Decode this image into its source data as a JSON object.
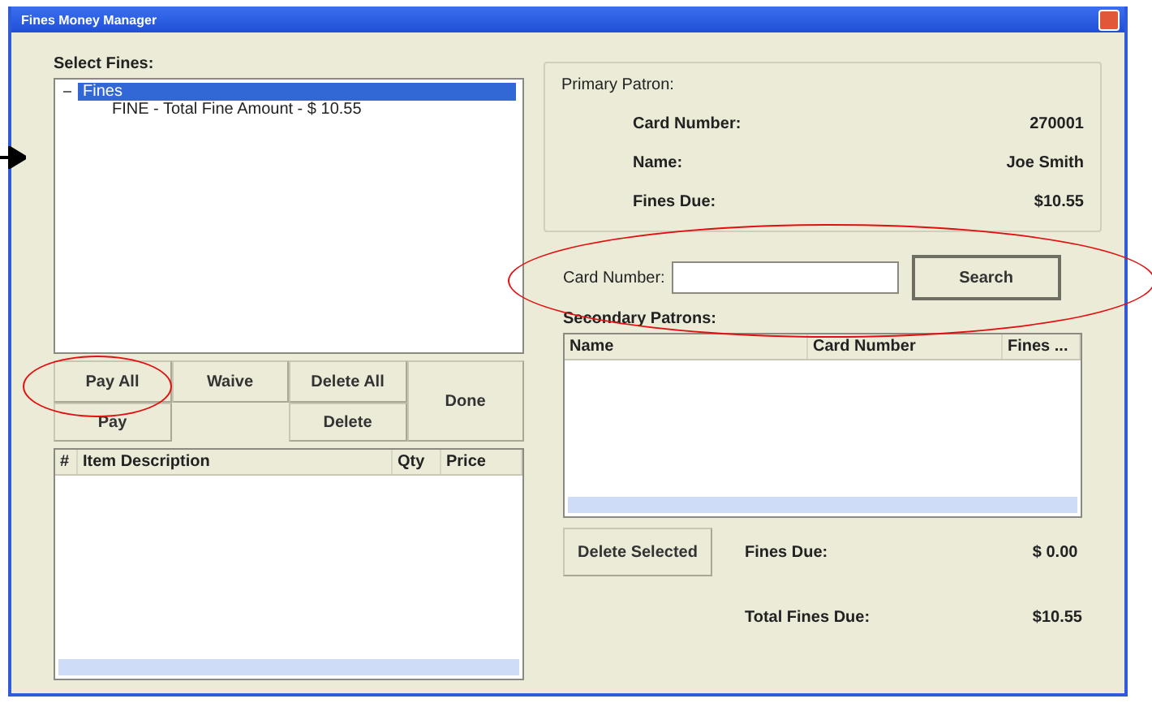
{
  "window": {
    "title": "Fines Money Manager"
  },
  "select_fines": {
    "label": "Select Fines:",
    "tree": [
      {
        "label": "Fines",
        "selected": true,
        "expanded": true,
        "children": [
          {
            "label": "FINE - Total Fine Amount - $ 10.55",
            "selected": false
          }
        ]
      }
    ]
  },
  "actions": [
    {
      "label": "Pay All"
    },
    {
      "label": "Waive"
    },
    {
      "label": "Delete All"
    },
    {
      "label": "Done"
    },
    {
      "label": "Pay"
    },
    {
      "label": "Delete"
    }
  ],
  "items_table": {
    "columns": [
      "#",
      "Item Description",
      "Qty",
      "Price"
    ]
  },
  "primary_patron": {
    "title": "Primary Patron:",
    "fields": [
      {
        "label": "Card Number:",
        "value": "270001"
      },
      {
        "label": "Name:",
        "value": "Joe Smith"
      },
      {
        "label": "Fines Due:",
        "value": "$10.55"
      }
    ]
  },
  "search": {
    "label": "Card Number:",
    "button": "Search"
  },
  "secondary_patrons": {
    "label": "Secondary Patrons:",
    "columns": [
      "Name",
      "Card Number",
      "Fines ..."
    ]
  },
  "delete_selected": "Delete Selected",
  "fines_due": {
    "label": "Fines Due:",
    "value": "$ 0.00"
  },
  "total_fines_due": {
    "label": "Total Fines Due:",
    "value": "$10.55"
  }
}
